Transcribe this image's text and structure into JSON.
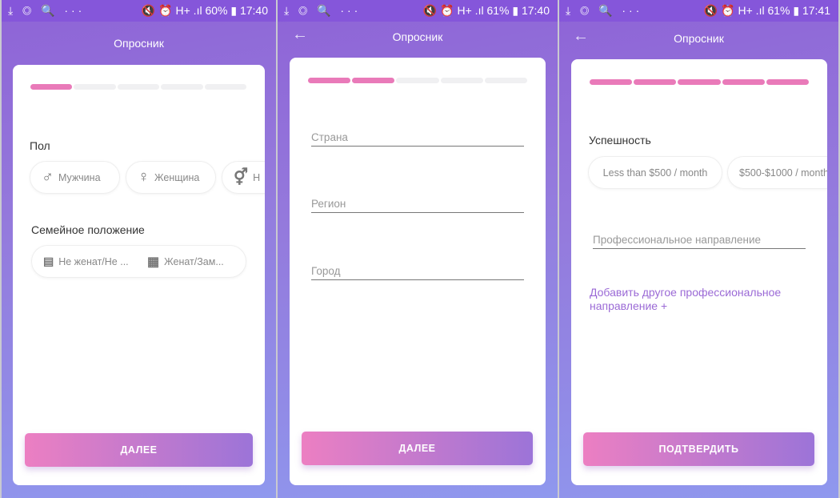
{
  "screens": [
    {
      "status": {
        "left": "⤓ ◎ 🔍 ···",
        "right": "🔇 ⏰ H+ .ıl 60% ▮ 17:40"
      },
      "title": "Опросник",
      "progress": 0.2,
      "gender_label": "Пол",
      "gender_options": [
        {
          "icon": "male-icon",
          "glyph": "♂",
          "label": "Мужчина"
        },
        {
          "icon": "female-icon",
          "glyph": "♀",
          "label": "Женщина"
        },
        {
          "icon": "other-gender-icon",
          "glyph": "⚥",
          "label": "Н"
        }
      ],
      "marital_label": "Семейное положение",
      "marital_options": [
        {
          "icon": "single-bed-icon",
          "label": "Не женат/Не ..."
        },
        {
          "icon": "double-bed-icon",
          "label": "Женат/Зам..."
        }
      ],
      "button": "ДАЛЕЕ"
    },
    {
      "status": {
        "left": "⤓ ◎ 🔍 ···",
        "right": "🔇 ⏰ H+ .ıl 61% ▮ 17:40"
      },
      "title": "Опросник",
      "progress": 0.4,
      "fields": [
        {
          "placeholder": "Страна"
        },
        {
          "placeholder": "Регион"
        },
        {
          "placeholder": "Город"
        }
      ],
      "button": "ДАЛЕЕ"
    },
    {
      "status": {
        "left": "⤓ ◎ 🔍 ···",
        "right": "🔇 ⏰ H+ .ıl 61% ▮ 17:41"
      },
      "title": "Опросник",
      "progress": 1.0,
      "success_label": "Успешность",
      "success_options": [
        "Less than $500 / month",
        "$500-$1000 / month"
      ],
      "field_placeholder": "Профессиональное направление",
      "add_link": "Добавить другое профессиональное направление +",
      "button": "ПОДТВЕРДИТЬ"
    }
  ],
  "colors": {
    "accent": "#e97ab9",
    "link": "#9b6ad6",
    "status_bar": "#8556da"
  }
}
